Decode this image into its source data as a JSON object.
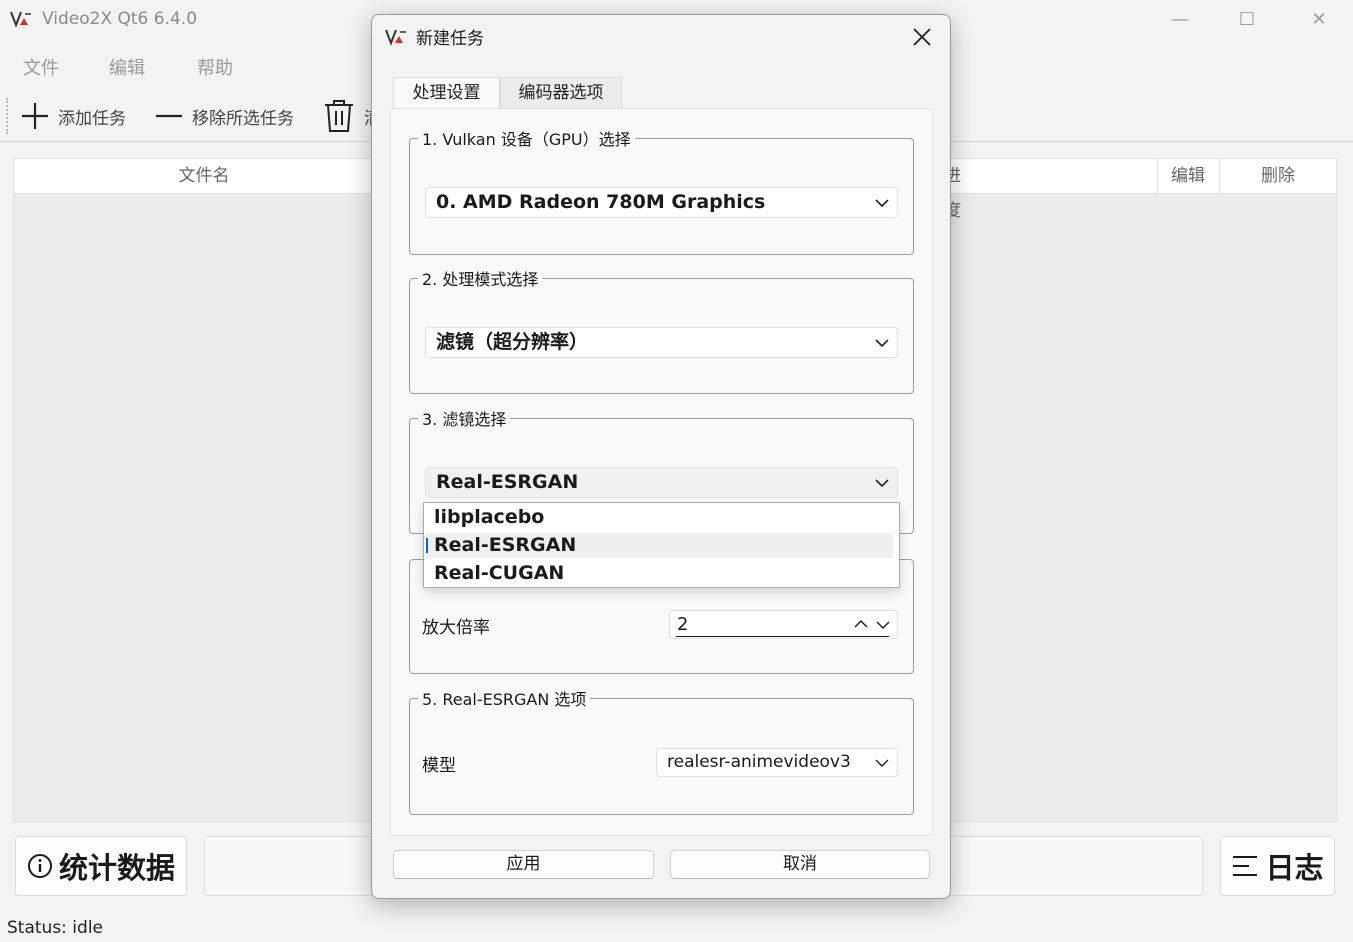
{
  "app": {
    "title": "Video2X Qt6 6.4.0",
    "window_controls": {
      "minimize": "—",
      "maximize": "☐",
      "close": "✕"
    }
  },
  "menu": {
    "items": [
      "文件",
      "编辑",
      "帮助"
    ]
  },
  "toolbar": {
    "add_task": {
      "icon": "plus-icon",
      "label": "添加任务"
    },
    "remove_selected": {
      "icon": "minus-icon",
      "label": "移除所选任务"
    },
    "clear": {
      "icon": "trash-icon",
      "label": "清"
    }
  },
  "table": {
    "columns": [
      "文件名",
      "进度",
      "编辑",
      "删除"
    ],
    "rows": []
  },
  "bottom": {
    "stats_button": {
      "icon": "info-icon",
      "label": "统计数据"
    },
    "log_button": {
      "icon": "list-icon",
      "label": "日志"
    }
  },
  "status": "Status: idle",
  "dialog": {
    "title": "新建任务",
    "tabs": [
      "处理设置",
      "编码器选项"
    ],
    "active_tab": "处理设置",
    "groups": {
      "gpu": {
        "title": "1. Vulkan 设备（GPU）选择",
        "value": "0. AMD Radeon 780M Graphics"
      },
      "mode": {
        "title": "2. 处理模式选择",
        "value": "滤镜（超分辨率）"
      },
      "filter": {
        "title": "3. 滤镜选择",
        "value": "Real-ESRGAN",
        "options": [
          "libplacebo",
          "Real-ESRGAN",
          "Real-CUGAN"
        ],
        "selected_index": 1
      },
      "scale": {
        "label": "放大倍率",
        "value": "2"
      },
      "esrgan": {
        "title": "5. Real-ESRGAN 选项",
        "model_label": "模型",
        "model_value": "realesr-animevideov3"
      }
    },
    "buttons": {
      "apply": "应用",
      "cancel": "取消"
    }
  },
  "colors": {
    "accent": "#0067c0",
    "window_bg": "#f3f3f3",
    "panel_bg": "#f9f9f9"
  }
}
